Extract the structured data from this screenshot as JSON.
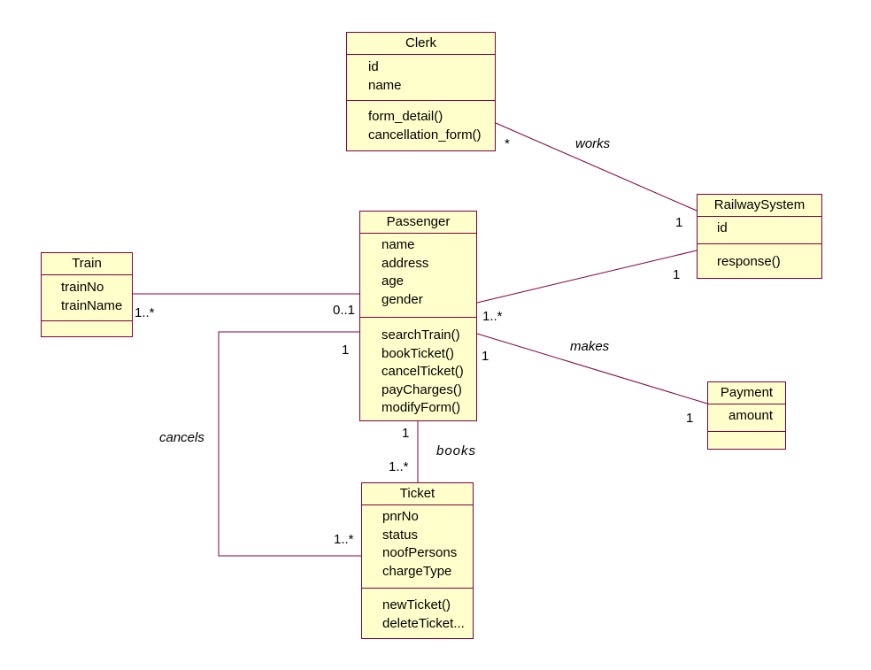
{
  "colors": {
    "class_fill": "#ffffcc",
    "class_border": "#800040",
    "link": "#800040",
    "background": "#ffffff"
  },
  "classes": {
    "clerk": {
      "name": "Clerk",
      "attributes": [
        "id",
        "name"
      ],
      "operations": [
        "form_detail()",
        "cancellation_form()"
      ]
    },
    "passenger": {
      "name": "Passenger",
      "attributes": [
        "name",
        "address",
        "age",
        "gender"
      ],
      "operations": [
        "searchTrain()",
        "bookTicket()",
        "cancelTicket()",
        "payCharges()",
        "modifyForm()"
      ]
    },
    "train": {
      "name": "Train",
      "attributes": [
        "trainNo",
        "trainName"
      ],
      "operations": []
    },
    "railway": {
      "name": "RailwaySystem",
      "attributes": [
        "id"
      ],
      "operations": [
        "response()"
      ]
    },
    "payment": {
      "name": "Payment",
      "attributes": [
        "amount"
      ],
      "operations": []
    },
    "ticket": {
      "name": "Ticket",
      "attributes": [
        "pnrNo",
        "status",
        "noofPersons",
        "chargeType"
      ],
      "operations": [
        "newTicket()",
        "deleteTicket..."
      ]
    }
  },
  "associations": {
    "works": {
      "label": "works",
      "from_mult": "*",
      "to_mult": "1"
    },
    "passenger_railway": {
      "from_mult": "1..*",
      "to_mult": "1"
    },
    "train_passenger": {
      "from_mult": "1..*",
      "to_mult": "0..1"
    },
    "makes": {
      "label": "makes",
      "from_mult": "1",
      "to_mult": "1"
    },
    "books": {
      "label": "books",
      "from_mult": "1",
      "to_mult": "1..*"
    },
    "cancels": {
      "label": "cancels",
      "from_mult": "1",
      "to_mult": "1..*"
    }
  }
}
